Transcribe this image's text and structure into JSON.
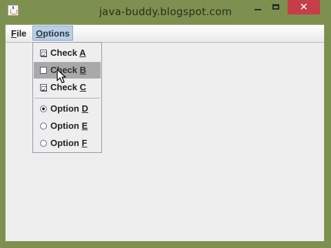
{
  "window": {
    "title": "java-buddy.blogspot.com",
    "icon": "java-cup-icon",
    "buttons": {
      "minimize": "minimize-icon",
      "maximize": "maximize-icon",
      "close": "✕"
    }
  },
  "menubar": {
    "file": {
      "label_first": "F",
      "label_rest": "ile"
    },
    "options": {
      "label_first": "O",
      "label_rest": "ptions"
    }
  },
  "options_menu": {
    "checks": [
      {
        "text": "Check ",
        "mnemonic": "A",
        "checked": true,
        "highlighted": false
      },
      {
        "text": "Check ",
        "mnemonic": "B",
        "checked": false,
        "highlighted": true
      },
      {
        "text": "Check ",
        "mnemonic": "C",
        "checked": true,
        "highlighted": false
      }
    ],
    "radios": [
      {
        "text": "Option ",
        "mnemonic": "D",
        "selected": true
      },
      {
        "text": "Option ",
        "mnemonic": "E",
        "selected": false
      },
      {
        "text": "Option ",
        "mnemonic": "F",
        "selected": false
      }
    ],
    "check_glyph": "☑"
  },
  "colors": {
    "frame": "#7e9050",
    "close": "#c53e4a",
    "menu_highlight": "#b8cfe5",
    "item_highlight": "#a9a9a9"
  }
}
